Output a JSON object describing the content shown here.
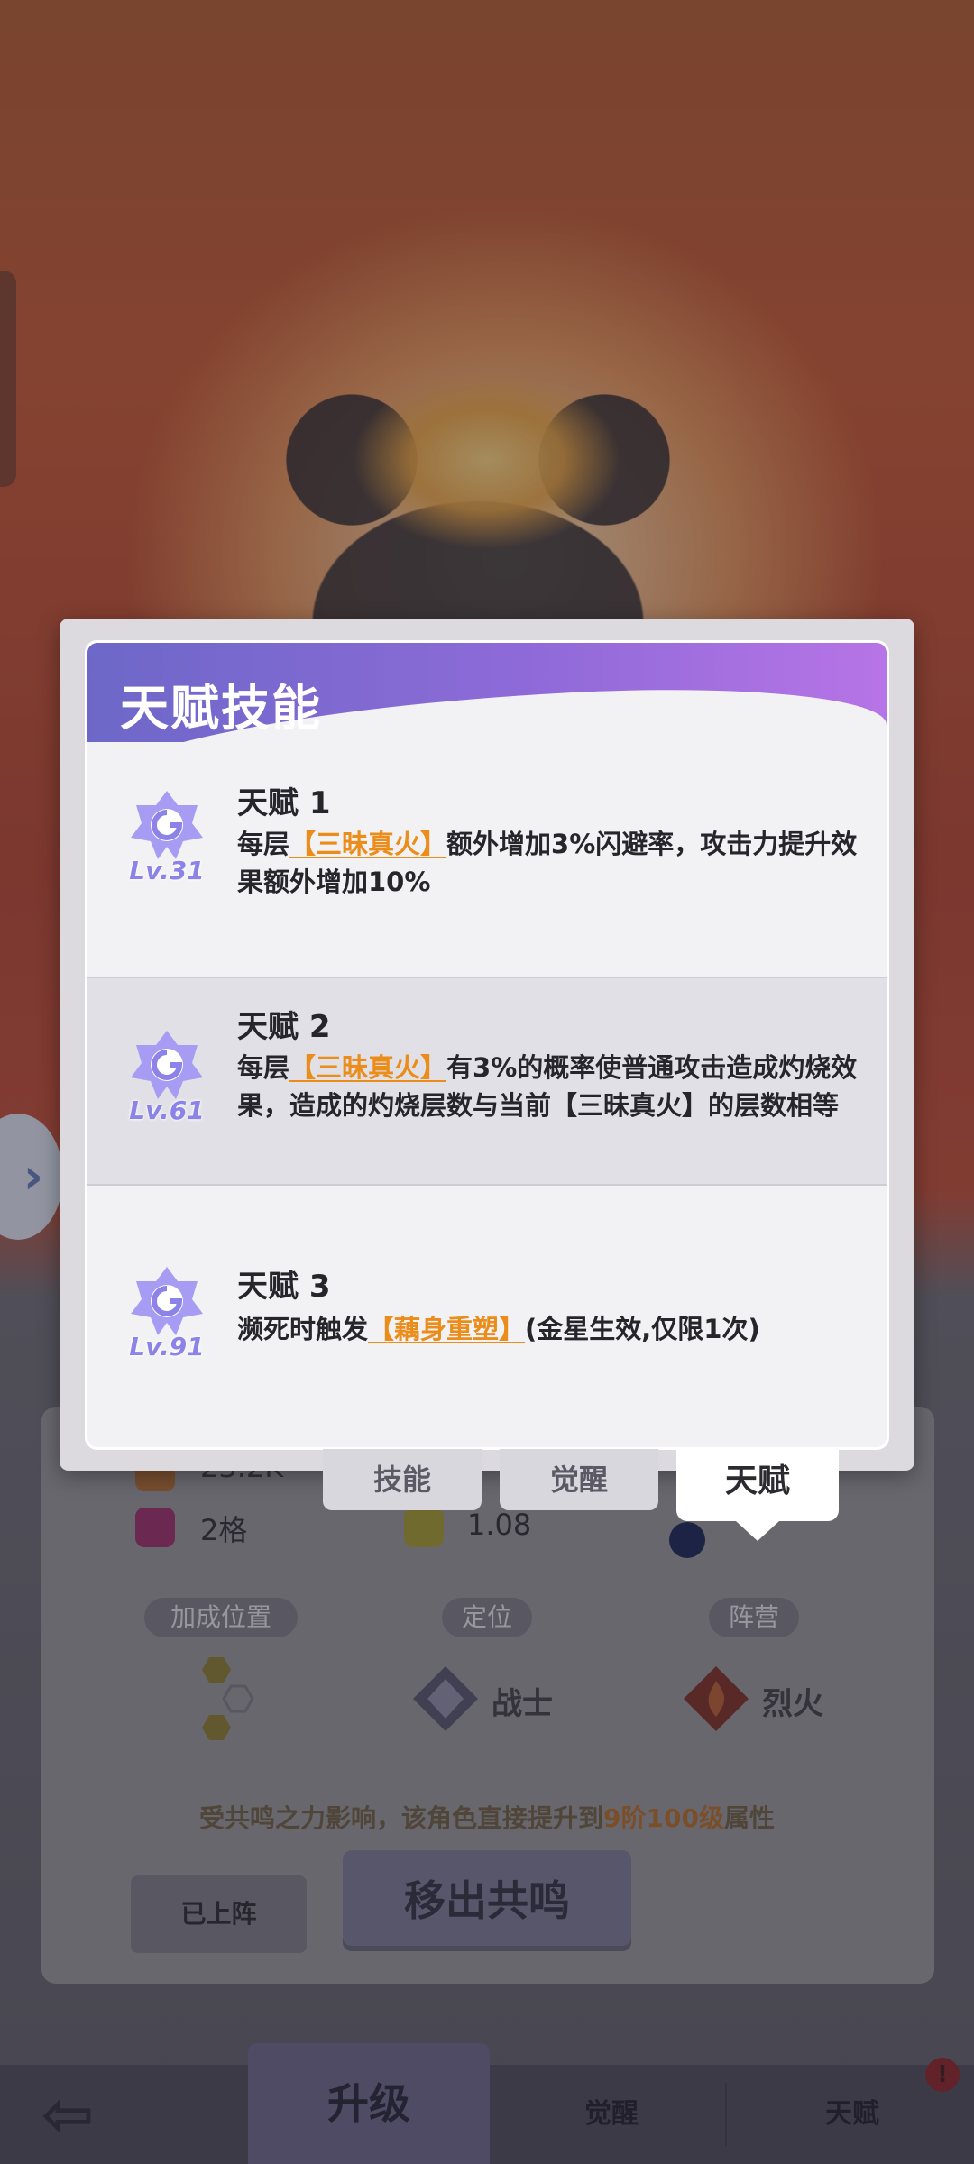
{
  "modal": {
    "title": "天赋技能",
    "talents": [
      {
        "name": "天赋 1",
        "level": "Lv.31",
        "desc_prefix": "每层",
        "keyword": "【三昧真火】",
        "desc_suffix": "额外增加3%闪避率，攻击力提升效果额外增加10%"
      },
      {
        "name": "天赋 2",
        "level": "Lv.61",
        "desc_prefix": "每层",
        "keyword": "【三昧真火】",
        "desc_suffix": "有3%的概率使普通攻击造成灼烧效果，造成的灼烧层数与当前【三昧真火】的层数相等"
      },
      {
        "name": "天赋 3",
        "level": "Lv.91",
        "desc_prefix": "濒死时触发",
        "keyword": "【藕身重塑】",
        "desc_suffix": "(金星生效,仅限1次)"
      }
    ]
  },
  "sub_tabs": {
    "skill": "技能",
    "awaken": "觉醒",
    "talent": "天赋"
  },
  "stats": {
    "attack_value": "23.2K",
    "grid_value": "2格",
    "speed_value": "1.08"
  },
  "info": {
    "bonus_position_label": "加成位置",
    "role_label": "定位",
    "faction_label": "阵营",
    "role_value": "战士",
    "faction_value": "烈火",
    "resonance_note_prefix": "受共鸣之力影响，该角色直接提升到",
    "resonance_note_highlight": "9阶100级",
    "resonance_note_suffix": "属性",
    "onboard_label": "已上阵",
    "remove_label": "移出共鸣"
  },
  "bottom_nav": {
    "upgrade": "升级",
    "awaken": "觉醒",
    "talent": "天赋",
    "alert": "!"
  },
  "colors": {
    "header_start": "#6d68c8",
    "header_end": "#b774e6",
    "keyword": "#eb8d1a",
    "level_text": "#8b83e8"
  }
}
